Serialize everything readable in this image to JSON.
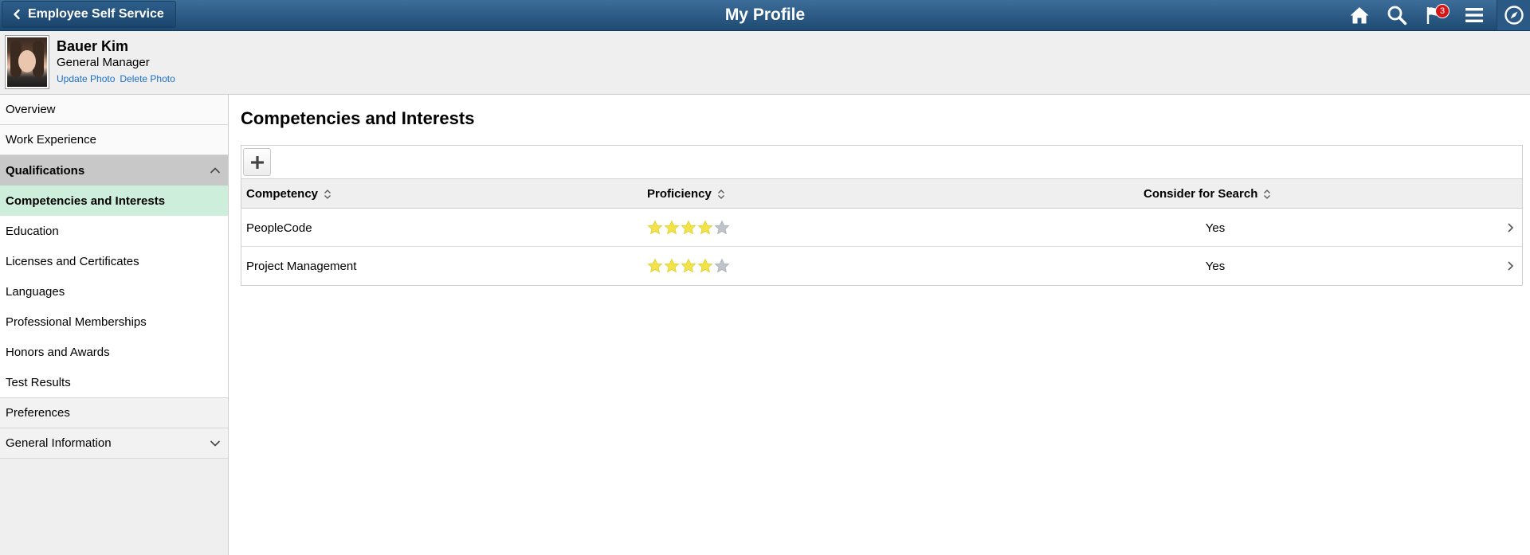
{
  "header": {
    "back_label": "Employee Self Service",
    "title": "My Profile",
    "notification_count": "3",
    "icons": [
      "home-icon",
      "search-icon",
      "notifications-flag-icon",
      "menu-icon",
      "navbar-compass-icon"
    ]
  },
  "profile": {
    "name": "Bauer Kim",
    "job_title": "General Manager",
    "update_photo": "Update Photo",
    "delete_photo": "Delete Photo"
  },
  "sidebar": {
    "overview": "Overview",
    "work_experience": "Work Experience",
    "qualifications": "Qualifications",
    "sub_items": [
      "Competencies and Interests",
      "Education",
      "Licenses and Certificates",
      "Languages",
      "Professional Memberships",
      "Honors and Awards",
      "Test Results"
    ],
    "preferences": "Preferences",
    "general_information": "General Information"
  },
  "main": {
    "section_title": "Competencies and Interests",
    "columns": {
      "competency": "Competency",
      "proficiency": "Proficiency",
      "consider": "Consider for Search"
    },
    "rows": [
      {
        "competency": "PeopleCode",
        "proficiency": 4,
        "proficiency_max": 5,
        "consider": "Yes"
      },
      {
        "competency": "Project Management",
        "proficiency": 4,
        "proficiency_max": 5,
        "consider": "Yes"
      }
    ]
  },
  "colors": {
    "header": "#2e5f8c",
    "active_nav": "#cdeedb",
    "star_on": "#f2e34a",
    "star_off": "#bfc4ca",
    "link": "#1a6fc9"
  }
}
